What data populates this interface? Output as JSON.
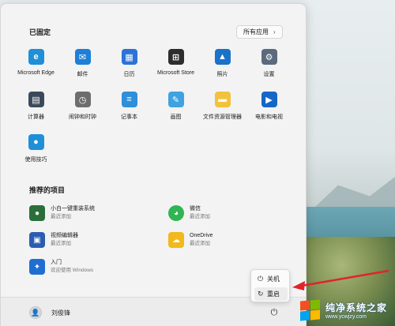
{
  "start_menu": {
    "pinned_title": "已固定",
    "all_apps_label": "所有应用",
    "pinned_apps": [
      {
        "label": "Microsoft Edge",
        "icon": "edge-icon",
        "color": "#1f8fd8",
        "glyph": "e"
      },
      {
        "label": "邮件",
        "icon": "mail-icon",
        "color": "#1e7fd6",
        "glyph": "✉"
      },
      {
        "label": "日历",
        "icon": "calendar-icon",
        "color": "#2b73d6",
        "glyph": "▦"
      },
      {
        "label": "Microsoft Store",
        "icon": "store-icon",
        "color": "#2d2d2d",
        "glyph": "⊞"
      },
      {
        "label": "照片",
        "icon": "photos-icon",
        "color": "#1a72c9",
        "glyph": "▲"
      },
      {
        "label": "设置",
        "icon": "settings-icon",
        "color": "#5b6b7d",
        "glyph": "⚙"
      },
      {
        "label": "计算器",
        "icon": "calculator-icon",
        "color": "#3b4a5a",
        "glyph": "▤"
      },
      {
        "label": "闹钟和时钟",
        "icon": "clock-icon",
        "color": "#6d6d6d",
        "glyph": "◷"
      },
      {
        "label": "记事本",
        "icon": "notepad-icon",
        "color": "#2f8fd9",
        "glyph": "≡"
      },
      {
        "label": "画图",
        "icon": "paint-icon",
        "color": "#3ea3e0",
        "glyph": "✎"
      },
      {
        "label": "文件资源管理器",
        "icon": "folder-icon",
        "color": "#f3c23c",
        "glyph": "▬"
      },
      {
        "label": "电影和电视",
        "icon": "movies-icon",
        "color": "#1567c7",
        "glyph": "▶"
      },
      {
        "label": "使用技巧",
        "icon": "tips-icon",
        "color": "#1f8fd8",
        "glyph": "●"
      }
    ],
    "recommended_title": "推荐的项目",
    "recommended": [
      {
        "name": "小白一键重装系统",
        "sub": "最近添加",
        "icon": "xiaobai-icon",
        "color": "#2a6f3a"
      },
      {
        "name": "微信",
        "sub": "最近添加",
        "icon": "wechat-icon",
        "color": "#2fb553"
      },
      {
        "name": "视频编辑器",
        "sub": "最近添加",
        "icon": "video-editor-icon",
        "color": "#2a5db0"
      },
      {
        "name": "OneDrive",
        "sub": "最近添加",
        "icon": "onedrive-icon",
        "color": "#f2b81c"
      },
      {
        "name": "入门",
        "sub": "欢迎使用 Windows",
        "icon": "getstarted-icon",
        "color": "#1f6fd1"
      }
    ],
    "user_name": "刘俊锋"
  },
  "power_menu": {
    "items": [
      {
        "label": "关机",
        "icon": "power-icon"
      },
      {
        "label": "重启",
        "icon": "restart-icon"
      }
    ]
  },
  "watermark": {
    "main": "纯净系统之家",
    "sub": "www.ycwjzy.com"
  },
  "colors": {
    "annotation_arrow": "#e0242a"
  }
}
